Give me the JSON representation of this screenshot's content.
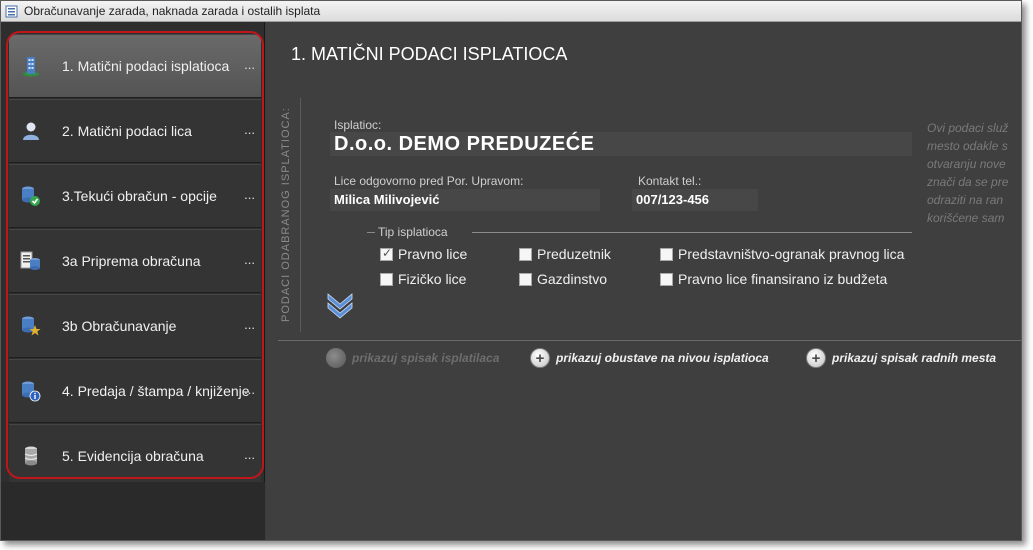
{
  "window": {
    "title": "Obračunavanje zarada, naknada zarada i ostalih isplata"
  },
  "sidebar": {
    "items": [
      {
        "label": "1. Matični podaci isplatioca",
        "dots": "...",
        "icon": "building-icon",
        "active": true
      },
      {
        "label": "2. Matični podaci lica",
        "dots": "...",
        "icon": "person-icon",
        "active": false
      },
      {
        "label": "3.Tekući obračun - opcije",
        "dots": "...",
        "icon": "database-check-icon",
        "active": false
      },
      {
        "label": "3a Priprema obračuna",
        "dots": "...",
        "icon": "database-list-icon",
        "active": false
      },
      {
        "label": "3b Obračunavanje",
        "dots": "...",
        "icon": "database-star-icon",
        "active": false
      },
      {
        "label": "4. Predaja / štampa / knjiženje",
        "dots": "...",
        "icon": "database-info-icon",
        "active": false
      },
      {
        "label": "5. Evidencija obračuna",
        "dots": "...",
        "icon": "database-icon",
        "active": false
      }
    ]
  },
  "main": {
    "title": "1. MATIČNI PODACI ISPLATIOCA",
    "vertical_label": "PODACI ODABRANOG ISPLATIOCA:",
    "isplatioc": {
      "label": "Isplatioc:",
      "value": "D.o.o. DEMO PREDUZEĆE"
    },
    "lice": {
      "label": "Lice odgovorno pred Por. Upravom:",
      "value": "Milica Milivojević"
    },
    "kontakt": {
      "label": "Kontakt tel.:",
      "value": "007/123-456"
    },
    "info_lines": [
      "Ovi podaci služ",
      "mesto odakle s",
      "otvaranju nove",
      "znači da se pre",
      "odraziti na ran",
      "korišćene sam"
    ],
    "tip": {
      "legend": "Tip isplatioca",
      "options": [
        {
          "label": "Pravno lice",
          "checked": true
        },
        {
          "label": "Preduzetnik",
          "checked": false
        },
        {
          "label": "Predstavništvo-ogranak pravnog lica",
          "checked": false
        },
        {
          "label": "Fizičko lice",
          "checked": false
        },
        {
          "label": "Gazdinstvo",
          "checked": false
        },
        {
          "label": "Pravno lice finansirano iz budžeta",
          "checked": false
        }
      ]
    },
    "actions": [
      {
        "label": "prikazuj spisak isplatilaca",
        "enabled": false
      },
      {
        "label": "prikazuj obustave na nivou isplatioca",
        "enabled": true
      },
      {
        "label": "prikazuj spisak radnih mesta",
        "enabled": true
      }
    ]
  },
  "colors": {
    "window_bg": "#3c3c3c",
    "sidebar_bg": "#2e2e2e",
    "highlight_border": "#c0161a",
    "field_bg": "#474747",
    "expand_accent": "#5b8fd6"
  }
}
